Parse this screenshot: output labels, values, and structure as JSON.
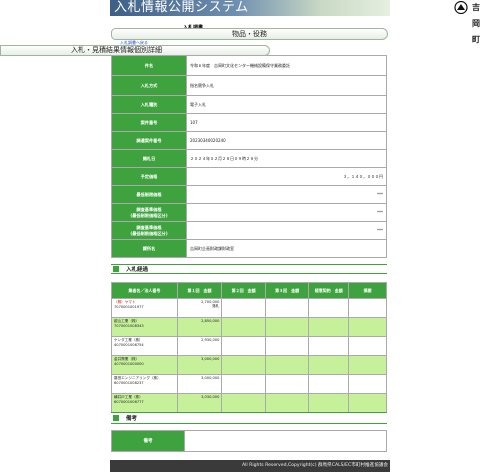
{
  "header": {
    "site_title": "入札情報公開システム",
    "town_name": "吉岡町"
  },
  "nav": {
    "section_heading": "入札調書",
    "category_tab": "物品・役務",
    "back_link": "入札調書へ戻る",
    "page_title": "入札・見積結果情報個別詳細"
  },
  "info": [
    {
      "label": "件名",
      "value": "令和６年度　吉岡町文化センター機械設備保守業務委託"
    },
    {
      "label": "入札方式",
      "value": "指名競争入札"
    },
    {
      "label": "入札種別",
      "value": "電子入札"
    },
    {
      "label": "案件番号",
      "value": "107"
    },
    {
      "label": "調達案件番号",
      "value": "20230340020240"
    },
    {
      "label": "開札日",
      "value": "２０２４年０２月２８日０９時２８分"
    },
    {
      "label": "予定価格",
      "value": "３，１４０，０００円",
      "align": "r"
    },
    {
      "label": "最低制限価格",
      "value": "***",
      "align": "r"
    },
    {
      "label": "調査基準価格\n(最低制限価格区分)",
      "value": "***",
      "align": "r"
    },
    {
      "label": "調査基準価格\n(最低制限価格区分)",
      "value": "***",
      "align": "r"
    },
    {
      "label": "課所名",
      "value": "吉岡町企画財政課財政室"
    }
  ],
  "results": {
    "section_title": "入札経過",
    "headers": [
      "業者名／法人番号",
      "第１回　金額",
      "第２回　金額",
      "第３回　金額",
      "随意契約　金額",
      "摘要"
    ],
    "rows": [
      {
        "name": "（株）ヤマト",
        "corp": "7070001001977",
        "amount": "2,700,000",
        "note": "落札",
        "winner": true
      },
      {
        "name": "越山工業（株）",
        "corp": "7070001008343",
        "amount": "2,850,000"
      },
      {
        "name": "ケンダ工業（株）",
        "corp": "4070001006754",
        "amount": "2,930,000"
      },
      {
        "name": "金井興業（株）",
        "corp": "4070001000000",
        "amount": "3,000,000"
      },
      {
        "name": "藤田エンジニアリング（株）",
        "corp": "6070001008237",
        "amount": "3,000,000"
      },
      {
        "name": "横井戸工業（株）",
        "corp": "6070001006777",
        "amount": "3,030,000"
      }
    ]
  },
  "remarks": {
    "section_title": "備考",
    "label": "備考",
    "value": ""
  },
  "footer": {
    "copyright": "All Rights Reserved,Copyright(c) 群馬県CALS/EC市町村推進協議会"
  },
  "colors": {
    "accent_green": "#3ea33e",
    "row_green": "#c6f09a"
  }
}
